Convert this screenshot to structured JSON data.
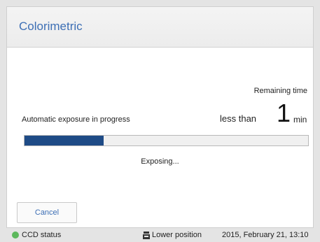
{
  "window": {
    "title": "Colorimetric"
  },
  "exposure": {
    "progress_label": "Automatic exposure in progress",
    "remaining_label": "Remaining time",
    "remaining_prefix": "less than",
    "remaining_value": "1",
    "remaining_unit": "min",
    "progress_fraction": 0.28,
    "status_text": "Exposing..."
  },
  "buttons": {
    "cancel_label": "Cancel"
  },
  "statusbar": {
    "ccd_label": "CCD status",
    "ccd_color": "#5cb85c",
    "position_icon": "tray-icon",
    "position_label": "Lower position",
    "datetime": "2015, February 21, 13:10"
  },
  "colors": {
    "accent": "#3d6fb5",
    "progress_fill": "#1e4b86"
  }
}
